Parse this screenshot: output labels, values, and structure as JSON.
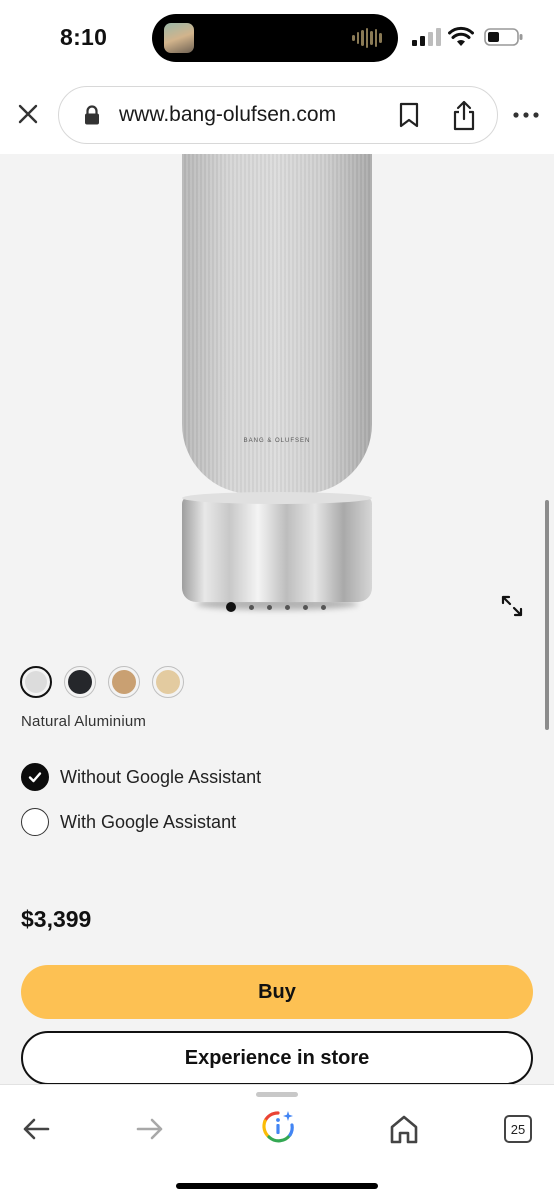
{
  "status_bar": {
    "time": "8:10",
    "icons": [
      "cellular-signal-icon",
      "wifi-icon",
      "battery-icon"
    ]
  },
  "browser": {
    "url": "www.bang-olufsen.com",
    "icons": [
      "close-icon",
      "lock-icon",
      "bookmark-icon",
      "share-icon",
      "more-icon"
    ]
  },
  "product": {
    "image_brand_mark": "BANG & OLUFSEN",
    "gallery": {
      "total_images": 6,
      "active_index": 0
    },
    "colors": [
      {
        "hex": "#dcdcdc",
        "selected": true
      },
      {
        "hex": "#25272b",
        "selected": false
      },
      {
        "hex": "#c9a072",
        "selected": false
      },
      {
        "hex": "#e3cba0",
        "selected": false
      }
    ],
    "selected_color_name": "Natural Aluminium",
    "options": [
      {
        "label": "Without Google Assistant",
        "selected": true
      },
      {
        "label": "With Google Assistant",
        "selected": false
      }
    ],
    "price": "$3,399",
    "buy_label": "Buy",
    "store_label": "Experience in store"
  },
  "bottom_nav": {
    "tab_count": "25",
    "icons": [
      "back-arrow-icon",
      "forward-arrow-icon",
      "google-lens-icon",
      "home-icon",
      "tabs-icon"
    ]
  },
  "colors": {
    "accent_button": "#fdc153",
    "page_background": "#f3f3f3"
  }
}
